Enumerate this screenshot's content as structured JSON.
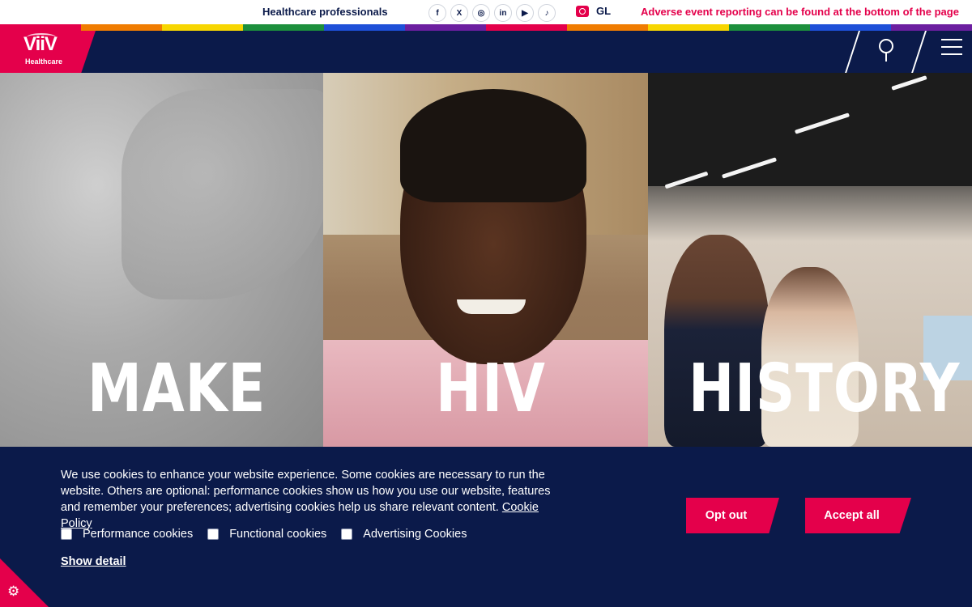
{
  "topbar": {
    "hcp_link": "Healthcare professionals",
    "socials": [
      {
        "icon": "facebook-icon",
        "glyph": "f"
      },
      {
        "icon": "x-icon",
        "glyph": "X"
      },
      {
        "icon": "instagram-icon",
        "glyph": "◎"
      },
      {
        "icon": "linkedin-icon",
        "glyph": "in"
      },
      {
        "icon": "youtube-icon",
        "glyph": "▶"
      },
      {
        "icon": "tiktok-icon",
        "glyph": "♪"
      }
    ],
    "language": "GL",
    "adverse_event": "Adverse event reporting can be found at the bottom of the page"
  },
  "rainbow_colors": [
    "#e4004b",
    "#f07c00",
    "#f7d600",
    "#1c8f3c",
    "#1e50d8",
    "#6c1fa0",
    "#e4004b",
    "#f07c00",
    "#f7d600",
    "#1c8f3c",
    "#1e50d8",
    "#6c1fa0"
  ],
  "brand": {
    "logo_main": "ViiV",
    "logo_sub": "Healthcare",
    "accent": "#e4004b",
    "navy": "#0b1a4a"
  },
  "nav": {
    "search_icon": "search-icon",
    "menu_icon": "hamburger-menu-icon"
  },
  "hero": {
    "word1": "MAKE",
    "word2": "HIV",
    "word3": "HISTORY"
  },
  "cookie": {
    "message": "We use cookies to enhance your website experience. Some cookies are necessary to run the website. Others are optional: performance cookies show us how you use our website, features and remember your preferences; advertising cookies help us share relevant content.",
    "policy_link": "Cookie Policy",
    "options": [
      "Performance cookies",
      "Functional cookies",
      "Advertising Cookies"
    ],
    "show_detail": "Show detail",
    "opt_out": "Opt out",
    "accept_all": "Accept all",
    "settings_icon": "gear-icon"
  }
}
